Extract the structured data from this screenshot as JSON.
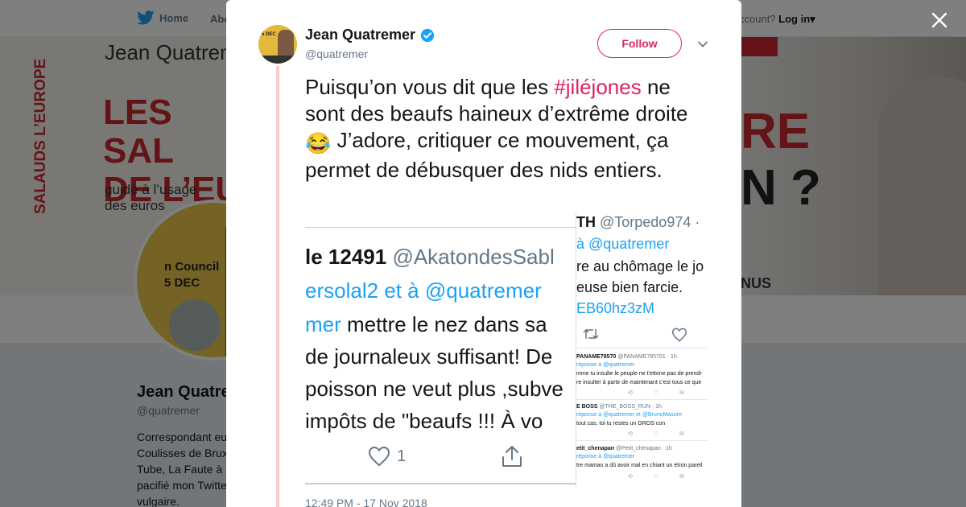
{
  "topbar": {
    "home_label": "Home",
    "about_label": "Abo",
    "account_text": "ccount?",
    "login_label": "Log in"
  },
  "banner": {
    "author": "Jean Quatrem",
    "title_line1": "LES SAL",
    "title_line2": "DE L’EU",
    "sub_line1": "guide à l’usage",
    "sub_line2": "des euros",
    "spine": "SALAUDS L’EUROPE",
    "right_big1": "RE",
    "right_big2": "N ?",
    "right_small": "NUS"
  },
  "avatar_big": {
    "text_line1": "n Council",
    "text_line2": "5 DEC"
  },
  "profile": {
    "name": "Jean Quatre",
    "handle": "@quatremer",
    "bio": [
      "Correspondant eu",
      "Coulisses de Brux",
      "Tube, La Faute à",
      "pacifié mon Twitte",
      "vulgaire."
    ]
  },
  "tweet": {
    "author_name": "Jean Quatremer",
    "author_handle": "@quatremer",
    "follow_label": "Follow",
    "text_before": "Puisqu’on vous dit que les ",
    "hashtag": "#jiléjones",
    "text_mid": " ne sont des beaufs haineux d’extrême droite ",
    "emoji": "😂",
    "text_after": " J’adore, critiquer ce mouvement, ça permet de débusquer des nids entiers.",
    "date": "12:49 PM - 17 Nov 2018",
    "avatar_text": "5 DEC",
    "media": {
      "left_line1_name": "le 12491",
      "left_line1_handle": " @AkatondesSabl",
      "left_line2": "ersolal2 et à @quatremer",
      "left_line3_blue": "mer",
      "left_line3_rest": " mettre le nez dans sa",
      "left_line4": "de journaleux suffisant! De",
      "left_line5": "poisson ne veut plus ,subve",
      "left_line6": "impôts de \"beaufs  !!! À vo",
      "left_like_count": "1",
      "right_line1_name": "TH",
      "right_line1_handle": " @Torpedo974 ·",
      "right_line2": "à @quatremer",
      "right_line3": "re au chômage le jo",
      "right_line4": "euse bien farcie.",
      "right_line5": "EB60hz3zM",
      "replies": [
        {
          "author": "PANAME78570",
          "handle": "@PANAME785701 · 1h",
          "to": "réponse à @quatremer",
          "text1": "mme tu insulte le peuple ne t’ettone pas de prendr",
          "text2": "re insulter à partir de maintenant c’est tous ce que"
        },
        {
          "author": "E BOSS",
          "handle": "@THE_BOSS_RUN · 1h",
          "to": "réponse à @quatremer et @BrunoMasure",
          "text1": "tout cas, toi tu restes un GROS con",
          "text2": ""
        },
        {
          "author": "etit_chenapan",
          "handle": "@Petit_chenapan · 1h",
          "to": "réponse à @quatremer",
          "text1": "tre maman a dû avoir mal en chiant un étron pareil",
          "text2": ""
        }
      ]
    }
  },
  "colors": {
    "accent": "#e0245e",
    "link_blue": "#1da1f2",
    "verified": "#1da1f2",
    "thread_line": "#fbc9c9"
  }
}
